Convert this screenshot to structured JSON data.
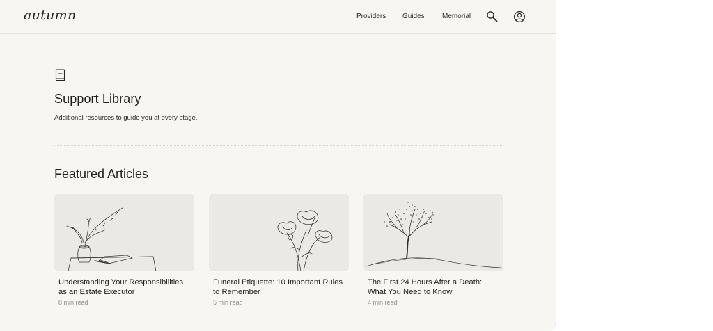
{
  "header": {
    "logo": "autumn",
    "nav": {
      "providers": "Providers",
      "guides": "Guides",
      "memorial": "Memorial"
    },
    "icons": [
      "search-icon",
      "account-icon"
    ]
  },
  "hero": {
    "icon": "book-icon",
    "title": "Support Library",
    "subtitle": "Additional resources to guide you at every stage."
  },
  "featured": {
    "title": "Featured Articles",
    "articles": [
      {
        "title": "Understanding Your Responsibilities as an Estate Executor",
        "meta": "8 min read",
        "image": "vase-with-branches-illustration"
      },
      {
        "title": "Funeral Etiquette: 10 Important Rules to Remember",
        "meta": "5 min read",
        "image": "poppy-flowers-illustration"
      },
      {
        "title": "The First 24 Hours After a Death: What You Need to Know",
        "meta": "4 min read",
        "image": "tree-on-hill-illustration"
      }
    ]
  },
  "colors": {
    "background": "#f7f6f2",
    "card_image_bg": "#ebe9e3",
    "text": "#1f1f1f",
    "muted": "#8f8d88"
  }
}
